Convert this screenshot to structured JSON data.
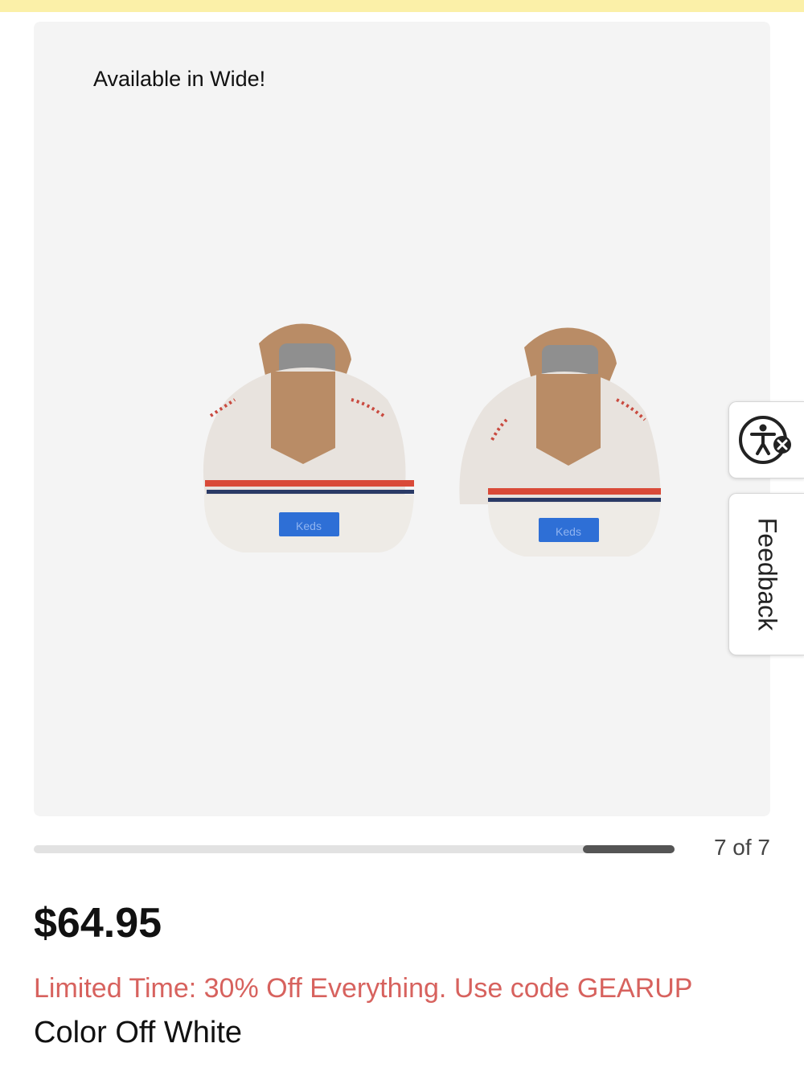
{
  "banner": {
    "color": "#fbf0a8"
  },
  "gallery": {
    "badge": "Available in Wide!",
    "image_icon": "shoe-pair-image",
    "counter": "7 of 7",
    "progress": {
      "current": 7,
      "total": 7
    }
  },
  "product": {
    "price": "$64.95",
    "promo": "Limited Time: 30% Off Everything. Use code GEARUP",
    "color": "Color Off White",
    "brand_tag": "Keds"
  },
  "side_widgets": {
    "accessibility_icon": "accessibility-icon",
    "feedback_label": "Feedback"
  },
  "colors": {
    "promo": "#d7625e",
    "progress_thumb": "#555555"
  }
}
